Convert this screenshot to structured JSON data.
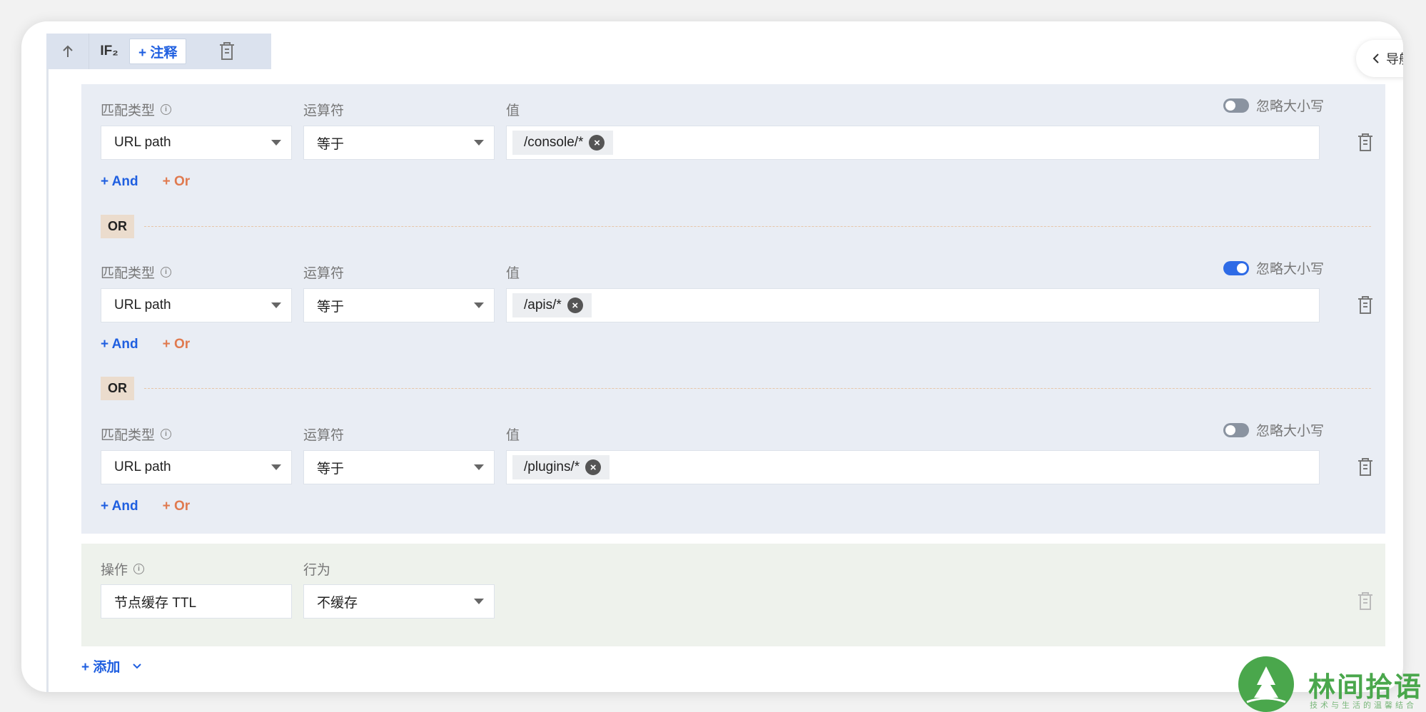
{
  "header": {
    "if_label": "IF₂",
    "note_button": "+ 注释"
  },
  "nav": {
    "label": "导航"
  },
  "labels": {
    "match_type": "匹配类型",
    "operator": "运算符",
    "value": "值",
    "ignore_case": "忽略大小写",
    "and": "+ And",
    "or": "+ Or",
    "or_badge": "OR"
  },
  "conditions": [
    {
      "match_type": "URL path",
      "operator": "等于",
      "value": "/console/*",
      "ignore_case": false
    },
    {
      "match_type": "URL path",
      "operator": "等于",
      "value": "/apis/*",
      "ignore_case": true
    },
    {
      "match_type": "URL path",
      "operator": "等于",
      "value": "/plugins/*",
      "ignore_case": false
    }
  ],
  "action": {
    "op_label": "操作",
    "behavior_label": "行为",
    "op_value": "节点缓存 TTL",
    "behavior_value": "不缓存"
  },
  "add_button": "+ 添加",
  "watermark": {
    "title": "林间拾语",
    "subtitle": "技术与生活的温馨结合"
  },
  "colors": {
    "accent": "#1f5fe0",
    "or_link": "#e07a4f",
    "toggle_on": "#2e6be6",
    "watermark": "#4aa74c"
  }
}
